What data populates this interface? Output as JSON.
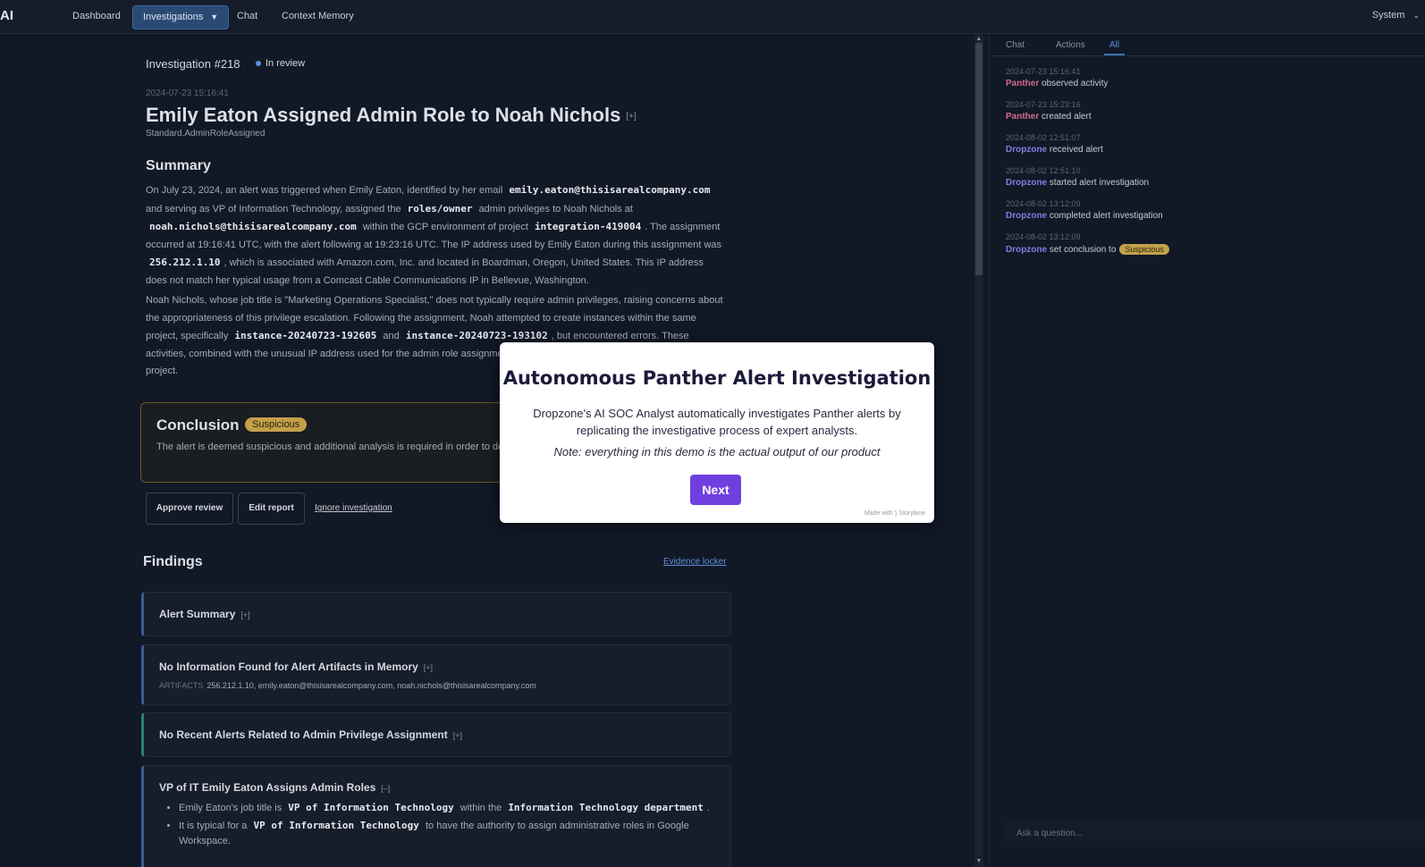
{
  "nav": {
    "logo": "AI",
    "items": [
      {
        "label": "Dashboard"
      },
      {
        "label": "Investigations"
      },
      {
        "label": "Chat"
      },
      {
        "label": "Context Memory"
      }
    ],
    "system_label": "System"
  },
  "investigation": {
    "heading": "Investigation #218",
    "status": "In review",
    "timestamp": "2024-07-23 15:16:41",
    "title": "Emily Eaton Assigned Admin Role to Noah Nichols",
    "expand": "[+]",
    "rule_id": "Standard.AdminRoleAssigned"
  },
  "summary": {
    "heading": "Summary",
    "p1": {
      "t1": "On July 23, 2024, an alert was triggered when Emily Eaton, identified by her email",
      "email": "emily.eaton@thisisarealcompany.com",
      "t2": "and serving as VP of Information Technology, assigned the",
      "role": "roles/owner",
      "t3": "admin privileges to Noah Nichols at",
      "email2": "noah.nichols@thisisarealcompany.com",
      "t4": "within the GCP environment of project",
      "project": "integration-419004",
      "t5": ". The assignment occurred at 19:16:41 UTC, with the alert following at 19:23:16 UTC. The IP address used by Emily Eaton during this assignment was",
      "ip": "256.212.1.10",
      "t6": ", which is associated with Amazon.com, Inc. and located in Boardman, Oregon, United States. This IP address does not match her typical usage from a Comcast Cable Communications IP in Bellevue, Washington."
    },
    "p2": {
      "t1": "Noah Nichols, whose job title is \"Marketing Operations Specialist,\" does not typically require admin privileges, raising concerns about the appropriateness of this privilege escalation. Following the assignment, Noah attempted to create instances within the same project, specifically",
      "inst1": "instance-20240723-192605",
      "t2": "and",
      "inst2": "instance-20240723-193102",
      "t3": ", but encountered errors. These activities, combined with the unusual IP address used for the admin role assignment, warrant further investigation within the GCP project."
    }
  },
  "conclusion": {
    "heading": "Conclusion",
    "badge": "Suspicious",
    "text": "The alert is deemed suspicious and additional analysis is required in order to determine whether it is malicious or benign."
  },
  "actions": {
    "approve": "Approve review",
    "edit": "Edit report",
    "ignore": "Ignore investigation"
  },
  "findings": {
    "heading": "Findings",
    "evidence_link": "Evidence locker",
    "cards": [
      {
        "title": "Alert Summary",
        "toggle": "[+]"
      },
      {
        "title": "No Information Found for Alert Artifacts in Memory",
        "toggle": "[+]",
        "artifacts_label": "ARTIFACTS",
        "artifacts": "256.212.1.10, emily.eaton@thisisarealcompany.com, noah.nichols@thisisarealcompany.com"
      },
      {
        "title": "No Recent Alerts Related to Admin Privilege Assignment",
        "toggle": "[+]"
      },
      {
        "title": "VP of IT Emily Eaton Assigns Admin Roles",
        "toggle": "[–]",
        "b1_t1": "Emily Eaton's job title is",
        "b1_c1": "VP of Information Technology",
        "b1_t2": "within the",
        "b1_c2": "Information Technology department",
        "b1_t3": ".",
        "b2_t1": "It is typical for a",
        "b2_c1": "VP of Information Technology",
        "b2_t2": "to have the authority to assign administrative roles in Google Workspace."
      }
    ]
  },
  "panel": {
    "tabs": [
      "Chat",
      "Actions",
      "All"
    ],
    "events": [
      {
        "time": "2024-07-23 15:16:41",
        "actor": "Panther",
        "text": "observed activity"
      },
      {
        "time": "2024-07-23 15:23:16",
        "actor": "Panther",
        "text": "created alert"
      },
      {
        "time": "2024-08-02 12:51:07",
        "actor": "Dropzone",
        "text": "received alert"
      },
      {
        "time": "2024-08-02 12:51:10",
        "actor": "Dropzone",
        "text": "started alert investigation"
      },
      {
        "time": "2024-08-02 13:12:09",
        "actor": "Dropzone",
        "text": "completed alert investigation"
      },
      {
        "time": "2024-08-02 13:12:09",
        "actor": "Dropzone",
        "text": "set conclusion to",
        "badge": "Suspicious"
      }
    ],
    "ask_placeholder": "Ask a question..."
  },
  "modal": {
    "title": "Autonomous Panther Alert Investigation",
    "description": "Dropzone's AI SOC Analyst automatically investigates Panther alerts by replicating the investigative process of expert analysts.",
    "note": "Note: everything in this demo is the actual output of our product",
    "next_label": "Next",
    "made_with": "Made with ⟆ Storylane"
  },
  "colors": {
    "accent": "#3b6fb4",
    "badge": "#c3a04a",
    "panther": "#d06a8f",
    "dropzone": "#7b7fe0",
    "modal_button": "#6f3fe0"
  }
}
